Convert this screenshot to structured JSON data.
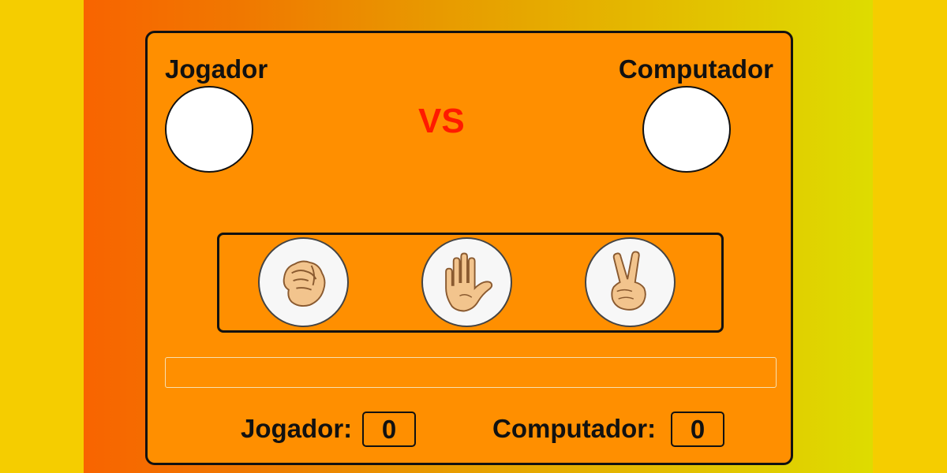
{
  "players": {
    "left_name": "Jogador",
    "right_name": "Computador",
    "versus": "VS"
  },
  "choices": [
    {
      "id": "rock",
      "icon": "fist-icon"
    },
    {
      "id": "paper",
      "icon": "open-hand-icon"
    },
    {
      "id": "scissors",
      "icon": "victory-hand-icon"
    }
  ],
  "result_text": "",
  "score": {
    "player_label": "Jogador:",
    "player_value": "0",
    "computer_label": "Computador:",
    "computer_value": "0"
  },
  "colors": {
    "board": "#ff8f00",
    "versus": "#ff1a00",
    "page_background": "#f5cd00",
    "skin": "#f2c48d"
  }
}
